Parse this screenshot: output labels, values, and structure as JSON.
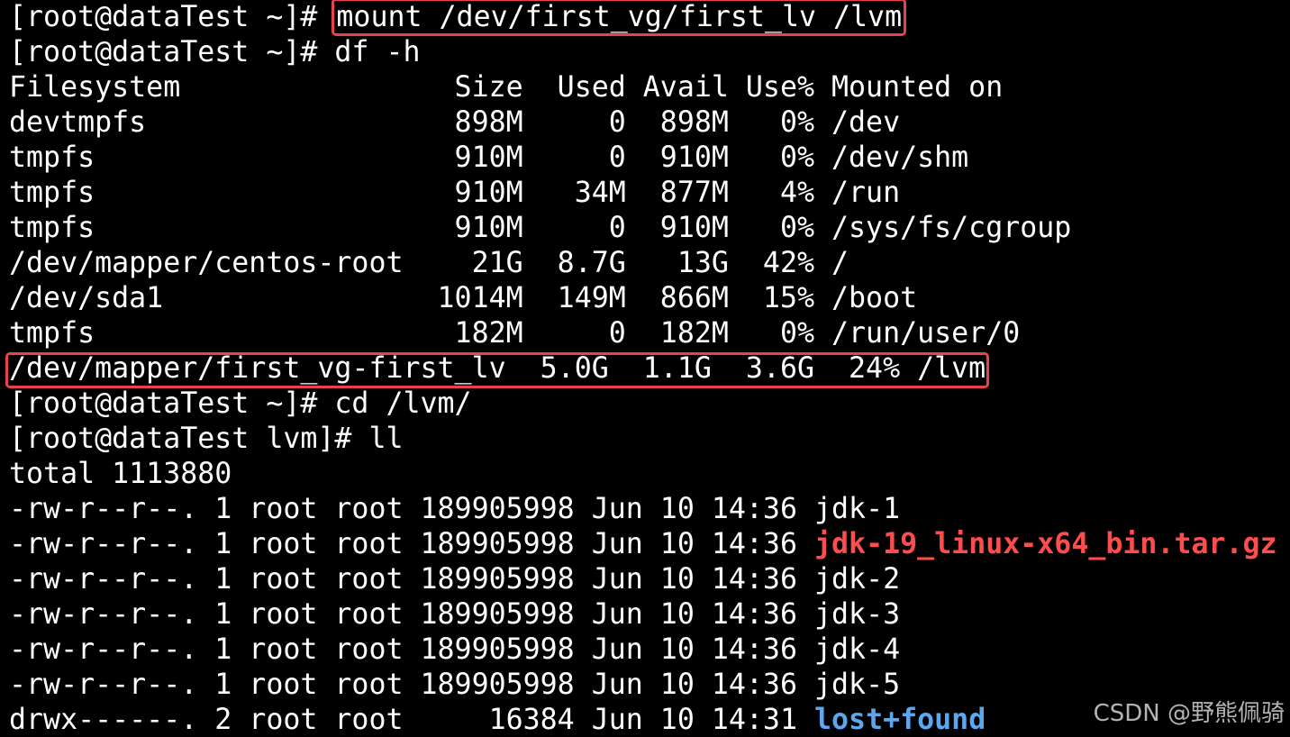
{
  "terminal": {
    "line1": {
      "prompt": "[root@dataTest ~]# ",
      "command": "mount /dev/first_vg/first_lv /lvm"
    },
    "line2": "[root@dataTest ~]# df -h",
    "df_rows": [
      "Filesystem                Size  Used Avail Use% Mounted on",
      "devtmpfs                  898M     0  898M   0% /dev",
      "tmpfs                     910M     0  910M   0% /dev/shm",
      "tmpfs                     910M   34M  877M   4% /run",
      "tmpfs                     910M     0  910M   0% /sys/fs/cgroup",
      "/dev/mapper/centos-root    21G  8.7G   13G  42% /",
      "/dev/sda1                1014M  149M  866M  15% /boot",
      "tmpfs                     182M     0  182M   0% /run/user/0",
      "/dev/mapper/first_vg-first_lv  5.0G  1.1G  3.6G  24% /lvm"
    ],
    "line_cd": "[root@dataTest ~]# cd /lvm/",
    "line_ll": "[root@dataTest lvm]# ll",
    "line_total": "total 1113880",
    "ls_rows": [
      {
        "meta": "-rw-r--r--. 1 root root 189905998 Jun 10 14:36 ",
        "name": "jdk-1"
      },
      {
        "meta": "-rw-r--r--. 1 root root 189905998 Jun 10 14:36 ",
        "name": "jdk-19_linux-x64_bin.tar.gz"
      },
      {
        "meta": "-rw-r--r--. 1 root root 189905998 Jun 10 14:36 ",
        "name": "jdk-2"
      },
      {
        "meta": "-rw-r--r--. 1 root root 189905998 Jun 10 14:36 ",
        "name": "jdk-3"
      },
      {
        "meta": "-rw-r--r--. 1 root root 189905998 Jun 10 14:36 ",
        "name": "jdk-4"
      },
      {
        "meta": "-rw-r--r--. 1 root root 189905998 Jun 10 14:36 ",
        "name": "jdk-5"
      },
      {
        "meta": "drwx------. 2 root root     16384 Jun 10 14:31 ",
        "name": "lost+found"
      }
    ]
  },
  "watermark": "CSDN @野熊佩骑",
  "colors": {
    "background": "#000000",
    "text": "#ffffff",
    "highlight_box": "#e8424e",
    "archive_file": "#ff4c4c",
    "directory": "#5ca8f0"
  }
}
